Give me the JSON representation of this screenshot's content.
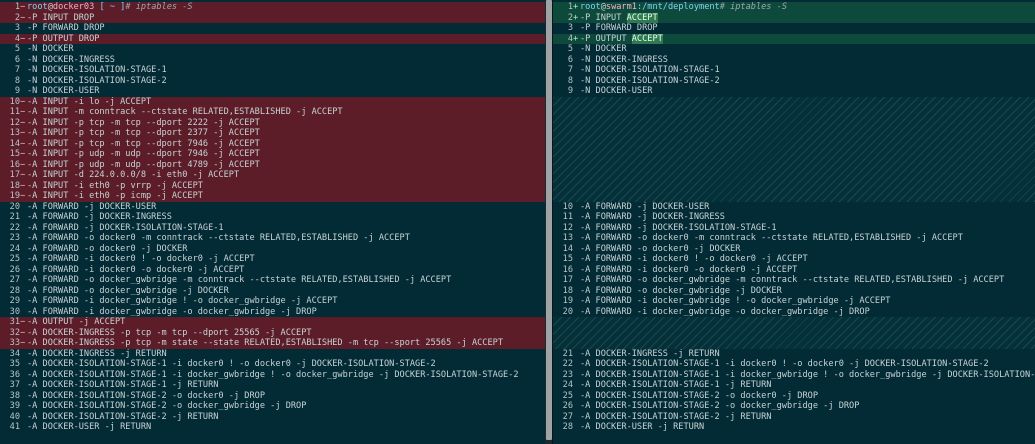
{
  "colors": {
    "background": "#022b35",
    "deleted_row": "#5c1d28",
    "added_row": "#0e4a3c",
    "added_highlight": "#2f7a52",
    "prompt_user": "#7fd4f5",
    "prompt_host": "#f4b0c8"
  },
  "left": {
    "prompt": {
      "user": "root",
      "at": "@",
      "host": "docker03",
      "path": " [ ~ ]",
      "cmd": "# iptables -S"
    },
    "lines": [
      {
        "n": "1",
        "m": "−",
        "t": "prompt",
        "type": "del"
      },
      {
        "n": "2",
        "m": "−",
        "t": "-P INPUT DROP",
        "type": "del"
      },
      {
        "n": "3",
        "m": "",
        "t": "-P FORWARD DROP",
        "type": "ctx"
      },
      {
        "n": "4",
        "m": "−",
        "t": "-P OUTPUT DROP",
        "type": "del"
      },
      {
        "n": "5",
        "m": "",
        "t": "-N DOCKER",
        "type": "ctx"
      },
      {
        "n": "6",
        "m": "",
        "t": "-N DOCKER-INGRESS",
        "type": "ctx"
      },
      {
        "n": "7",
        "m": "",
        "t": "-N DOCKER-ISOLATION-STAGE-1",
        "type": "ctx"
      },
      {
        "n": "8",
        "m": "",
        "t": "-N DOCKER-ISOLATION-STAGE-2",
        "type": "ctx"
      },
      {
        "n": "9",
        "m": "",
        "t": "-N DOCKER-USER",
        "type": "ctx"
      },
      {
        "n": "10",
        "m": "−",
        "t": "-A INPUT -i lo -j ACCEPT",
        "type": "del"
      },
      {
        "n": "11",
        "m": "−",
        "t": "-A INPUT -m conntrack --ctstate RELATED,ESTABLISHED -j ACCEPT",
        "type": "del"
      },
      {
        "n": "12",
        "m": "−",
        "t": "-A INPUT -p tcp -m tcp --dport 2222 -j ACCEPT",
        "type": "del"
      },
      {
        "n": "13",
        "m": "−",
        "t": "-A INPUT -p tcp -m tcp --dport 2377 -j ACCEPT",
        "type": "del"
      },
      {
        "n": "14",
        "m": "−",
        "t": "-A INPUT -p tcp -m tcp --dport 7946 -j ACCEPT",
        "type": "del"
      },
      {
        "n": "15",
        "m": "−",
        "t": "-A INPUT -p udp -m udp --dport 7946 -j ACCEPT",
        "type": "del"
      },
      {
        "n": "16",
        "m": "−",
        "t": "-A INPUT -p udp -m udp --dport 4789 -j ACCEPT",
        "type": "del"
      },
      {
        "n": "17",
        "m": "−",
        "t": "-A INPUT -d 224.0.0.0/8 -i eth0 -j ACCEPT",
        "type": "del"
      },
      {
        "n": "18",
        "m": "−",
        "t": "-A INPUT -i eth0 -p vrrp -j ACCEPT",
        "type": "del"
      },
      {
        "n": "19",
        "m": "−",
        "t": "-A INPUT -i eth0 -p icmp -j ACCEPT",
        "type": "del"
      },
      {
        "n": "20",
        "m": "",
        "t": "-A FORWARD -j DOCKER-USER",
        "type": "ctx"
      },
      {
        "n": "21",
        "m": "",
        "t": "-A FORWARD -j DOCKER-INGRESS",
        "type": "ctx"
      },
      {
        "n": "22",
        "m": "",
        "t": "-A FORWARD -j DOCKER-ISOLATION-STAGE-1",
        "type": "ctx"
      },
      {
        "n": "23",
        "m": "",
        "t": "-A FORWARD -o docker0 -m conntrack --ctstate RELATED,ESTABLISHED -j ACCEPT",
        "type": "ctx"
      },
      {
        "n": "24",
        "m": "",
        "t": "-A FORWARD -o docker0 -j DOCKER",
        "type": "ctx"
      },
      {
        "n": "25",
        "m": "",
        "t": "-A FORWARD -i docker0 ! -o docker0 -j ACCEPT",
        "type": "ctx"
      },
      {
        "n": "26",
        "m": "",
        "t": "-A FORWARD -i docker0 -o docker0 -j ACCEPT",
        "type": "ctx"
      },
      {
        "n": "27",
        "m": "",
        "t": "-A FORWARD -o docker_gwbridge -m conntrack --ctstate RELATED,ESTABLISHED -j ACCEPT",
        "type": "ctx"
      },
      {
        "n": "28",
        "m": "",
        "t": "-A FORWARD -o docker_gwbridge -j DOCKER",
        "type": "ctx"
      },
      {
        "n": "29",
        "m": "",
        "t": "-A FORWARD -i docker_gwbridge ! -o docker_gwbridge -j ACCEPT",
        "type": "ctx"
      },
      {
        "n": "30",
        "m": "",
        "t": "-A FORWARD -i docker_gwbridge -o docker_gwbridge -j DROP",
        "type": "ctx"
      },
      {
        "n": "31",
        "m": "−",
        "t": "-A OUTPUT -j ACCEPT",
        "type": "del"
      },
      {
        "n": "32",
        "m": "−",
        "t": "-A DOCKER-INGRESS -p tcp -m tcp --dport 25565 -j ACCEPT",
        "type": "del"
      },
      {
        "n": "33",
        "m": "−",
        "t": "-A DOCKER-INGRESS -p tcp -m state --state RELATED,ESTABLISHED -m tcp --sport 25565 -j ACCEPT",
        "type": "del"
      },
      {
        "n": "34",
        "m": "",
        "t": "-A DOCKER-INGRESS -j RETURN",
        "type": "ctx"
      },
      {
        "n": "35",
        "m": "",
        "t": "-A DOCKER-ISOLATION-STAGE-1 -i docker0 ! -o docker0 -j DOCKER-ISOLATION-STAGE-2",
        "type": "ctx"
      },
      {
        "n": "36",
        "m": "",
        "t": "-A DOCKER-ISOLATION-STAGE-1 -i docker_gwbridge ! -o docker_gwbridge -j DOCKER-ISOLATION-STAGE-2",
        "type": "ctx"
      },
      {
        "n": "37",
        "m": "",
        "t": "-A DOCKER-ISOLATION-STAGE-1 -j RETURN",
        "type": "ctx"
      },
      {
        "n": "38",
        "m": "",
        "t": "-A DOCKER-ISOLATION-STAGE-2 -o docker0 -j DROP",
        "type": "ctx"
      },
      {
        "n": "39",
        "m": "",
        "t": "-A DOCKER-ISOLATION-STAGE-2 -o docker_gwbridge -j DROP",
        "type": "ctx"
      },
      {
        "n": "40",
        "m": "",
        "t": "-A DOCKER-ISOLATION-STAGE-2 -j RETURN",
        "type": "ctx"
      },
      {
        "n": "41",
        "m": "",
        "t": "-A DOCKER-USER -j RETURN",
        "type": "ctx"
      }
    ]
  },
  "right": {
    "prompt": {
      "user": "root",
      "at": "@",
      "host": "swarm1",
      "path": ":/mnt/deployment",
      "cmd": "# iptables -S"
    },
    "lines": [
      {
        "n": "1",
        "m": "+",
        "t": "prompt",
        "type": "add"
      },
      {
        "n": "2",
        "m": "+",
        "t": "-P INPUT ",
        "hl": "ACCEPT",
        "type": "add"
      },
      {
        "n": "3",
        "m": "",
        "t": "-P FORWARD DROP",
        "type": "ctx"
      },
      {
        "n": "4",
        "m": "+",
        "t": "-P OUTPUT ",
        "hl": "ACCEPT",
        "type": "add"
      },
      {
        "n": "5",
        "m": "",
        "t": "-N DOCKER",
        "type": "ctx"
      },
      {
        "n": "6",
        "m": "",
        "t": "-N DOCKER-INGRESS",
        "type": "ctx"
      },
      {
        "n": "7",
        "m": "",
        "t": "-N DOCKER-ISOLATION-STAGE-1",
        "type": "ctx"
      },
      {
        "n": "8",
        "m": "",
        "t": "-N DOCKER-ISOLATION-STAGE-2",
        "type": "ctx"
      },
      {
        "n": "9",
        "m": "",
        "t": "-N DOCKER-USER",
        "type": "ctx"
      },
      {
        "type": "filler",
        "count": 10
      },
      {
        "n": "10",
        "m": "",
        "t": "-A FORWARD -j DOCKER-USER",
        "type": "ctx"
      },
      {
        "n": "11",
        "m": "",
        "t": "-A FORWARD -j DOCKER-INGRESS",
        "type": "ctx"
      },
      {
        "n": "12",
        "m": "",
        "t": "-A FORWARD -j DOCKER-ISOLATION-STAGE-1",
        "type": "ctx"
      },
      {
        "n": "13",
        "m": "",
        "t": "-A FORWARD -o docker0 -m conntrack --ctstate RELATED,ESTABLISHED -j ACCEPT",
        "type": "ctx"
      },
      {
        "n": "14",
        "m": "",
        "t": "-A FORWARD -o docker0 -j DOCKER",
        "type": "ctx"
      },
      {
        "n": "15",
        "m": "",
        "t": "-A FORWARD -i docker0 ! -o docker0 -j ACCEPT",
        "type": "ctx"
      },
      {
        "n": "16",
        "m": "",
        "t": "-A FORWARD -i docker0 -o docker0 -j ACCEPT",
        "type": "ctx"
      },
      {
        "n": "17",
        "m": "",
        "t": "-A FORWARD -o docker_gwbridge -m conntrack --ctstate RELATED,ESTABLISHED -j ACCEPT",
        "type": "ctx"
      },
      {
        "n": "18",
        "m": "",
        "t": "-A FORWARD -o docker_gwbridge -j DOCKER",
        "type": "ctx"
      },
      {
        "n": "19",
        "m": "",
        "t": "-A FORWARD -i docker_gwbridge ! -o docker_gwbridge -j ACCEPT",
        "type": "ctx"
      },
      {
        "n": "20",
        "m": "",
        "t": "-A FORWARD -i docker_gwbridge -o docker_gwbridge -j DROP",
        "type": "ctx"
      },
      {
        "type": "filler",
        "count": 3
      },
      {
        "n": "21",
        "m": "",
        "t": "-A DOCKER-INGRESS -j RETURN",
        "type": "ctx"
      },
      {
        "n": "22",
        "m": "",
        "t": "-A DOCKER-ISOLATION-STAGE-1 -i docker0 ! -o docker0 -j DOCKER-ISOLATION-STAGE-2",
        "type": "ctx"
      },
      {
        "n": "23",
        "m": "",
        "t": "-A DOCKER-ISOLATION-STAGE-1 -i docker_gwbridge ! -o docker_gwbridge -j DOCKER-ISOLATION-STAGE-2",
        "type": "ctx"
      },
      {
        "n": "24",
        "m": "",
        "t": "-A DOCKER-ISOLATION-STAGE-1 -j RETURN",
        "type": "ctx"
      },
      {
        "n": "25",
        "m": "",
        "t": "-A DOCKER-ISOLATION-STAGE-2 -o docker0 -j DROP",
        "type": "ctx"
      },
      {
        "n": "26",
        "m": "",
        "t": "-A DOCKER-ISOLATION-STAGE-2 -o docker_gwbridge -j DROP",
        "type": "ctx"
      },
      {
        "n": "27",
        "m": "",
        "t": "-A DOCKER-ISOLATION-STAGE-2 -j RETURN",
        "type": "ctx"
      },
      {
        "n": "28",
        "m": "",
        "t": "-A DOCKER-USER -j RETURN",
        "type": "ctx"
      }
    ]
  }
}
